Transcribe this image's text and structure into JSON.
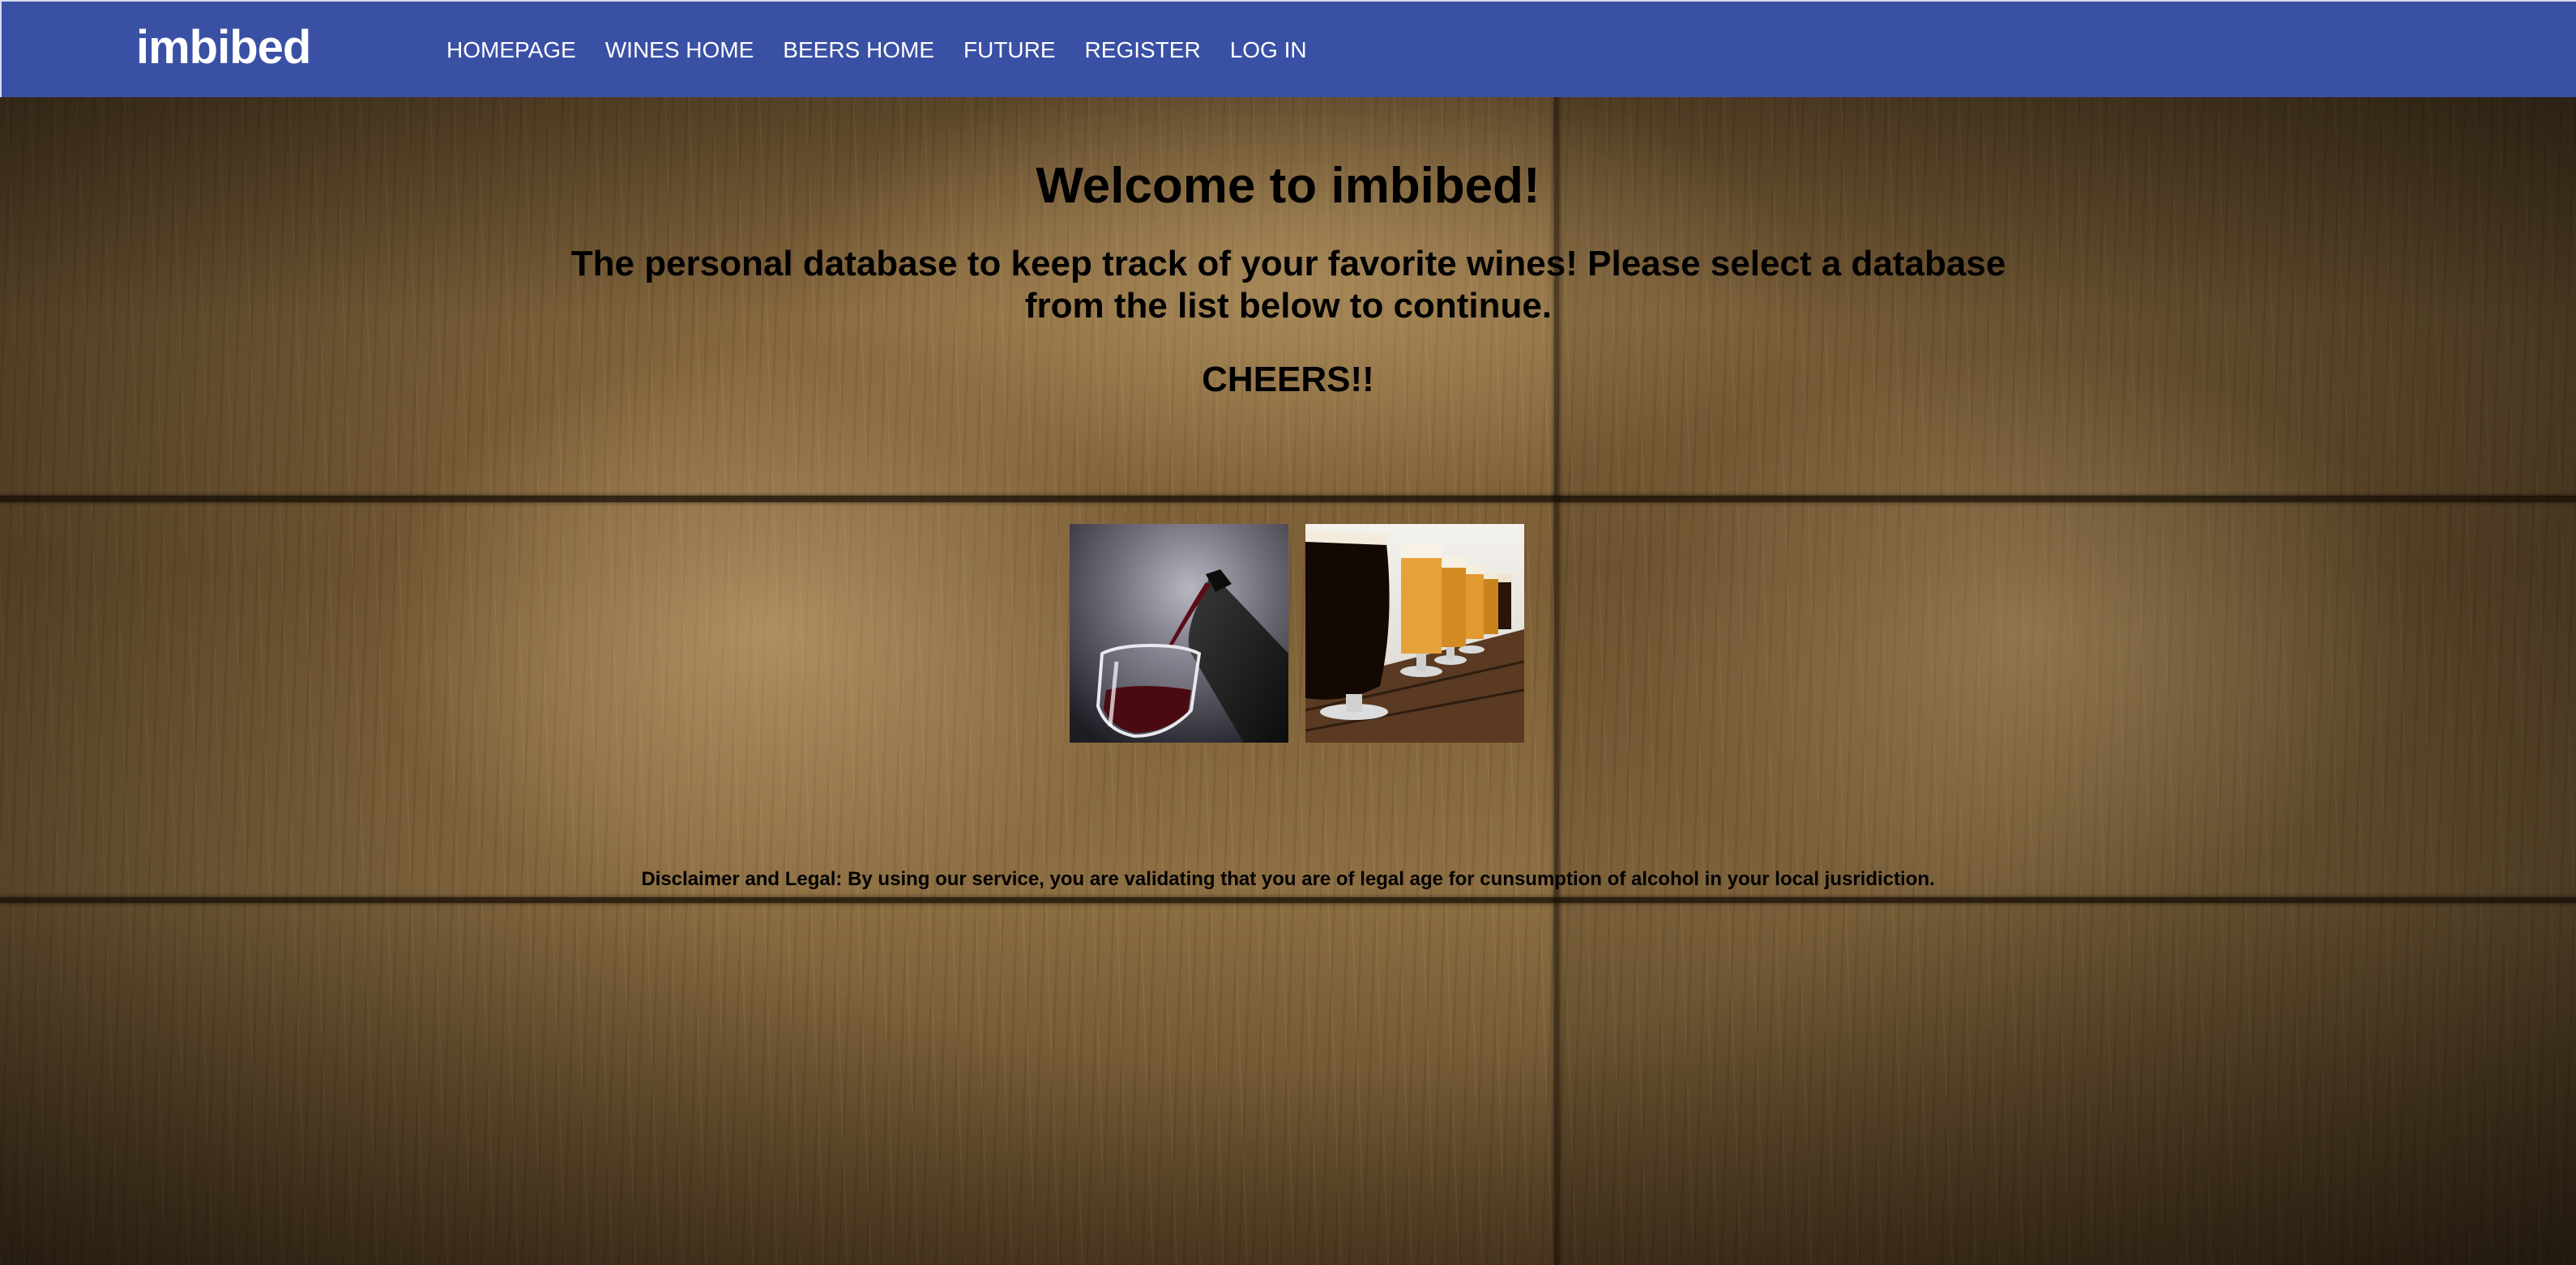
{
  "navbar": {
    "brand": "imbibed",
    "links": [
      {
        "label": "HOMEPAGE"
      },
      {
        "label": "WINES HOME"
      },
      {
        "label": "BEERS HOME"
      },
      {
        "label": "FUTURE"
      },
      {
        "label": "REGISTER"
      },
      {
        "label": "LOG IN"
      }
    ],
    "background_color": "#3a50a4"
  },
  "main": {
    "welcome": "Welcome to imbibed!",
    "tagline": "The personal database to keep track of your favorite wines! Please select a database from the list below to continue.",
    "cheers": "CHEERS!!",
    "tiles": [
      {
        "name": "wine",
        "icon": "wine-pouring-photo"
      },
      {
        "name": "beer",
        "icon": "beer-glasses-photo"
      }
    ],
    "disclaimer": "Disclaimer and Legal: By using our service, you are validating that you are of legal age for cunsumption of alcohol in your local jusridiction."
  }
}
